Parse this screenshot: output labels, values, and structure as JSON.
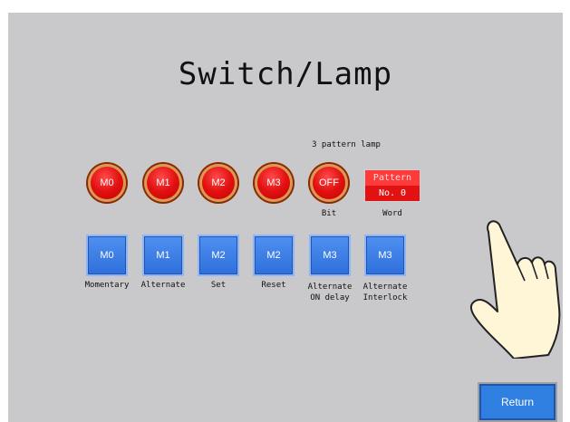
{
  "title": "Switch/Lamp",
  "pattern_caption": "3 pattern lamp",
  "lamps": [
    {
      "label": "M0"
    },
    {
      "label": "M1"
    },
    {
      "label": "M2"
    },
    {
      "label": "M3"
    },
    {
      "label": "OFF"
    }
  ],
  "pattern_lamp": {
    "line1": "Pattern",
    "line2": "No. 0"
  },
  "lamp_captions": {
    "bit": "Bit",
    "word": "Word"
  },
  "switches": [
    {
      "label": "M0",
      "caption1": "Momentary",
      "caption2": ""
    },
    {
      "label": "M1",
      "caption1": "Alternate",
      "caption2": ""
    },
    {
      "label": "M2",
      "caption1": "Set",
      "caption2": ""
    },
    {
      "label": "M2",
      "caption1": "Reset",
      "caption2": ""
    },
    {
      "label": "M3",
      "caption1": "Alternate",
      "caption2": "ON delay"
    },
    {
      "label": "M3",
      "caption1": "Alternate",
      "caption2": "Interlock"
    }
  ],
  "return_label": "Return",
  "colors": {
    "lamp_red": "#e21010",
    "switch_blue": "#2f6fdc",
    "panel_gray": "#c9c8ca"
  },
  "icons": {
    "hand": "pointing-hand-icon"
  }
}
